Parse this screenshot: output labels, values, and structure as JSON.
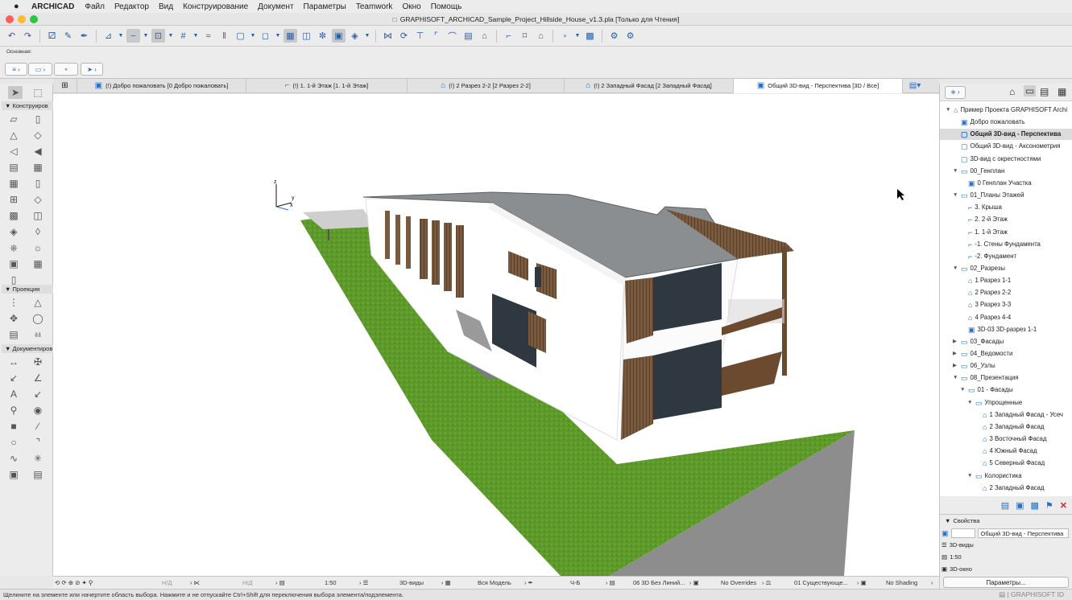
{
  "menubar": {
    "apple": "",
    "app_name": "ARCHICAD",
    "items": [
      "Файл",
      "Редактор",
      "Вид",
      "Конструирование",
      "Документ",
      "Параметры",
      "Teamwork",
      "Окно",
      "Помощь"
    ]
  },
  "window": {
    "title": "GRAPHISOFT_ARCHICAD_Sample_Project_Hillside_House_v1.3.pla [Только для Чтения]"
  },
  "infobox": {
    "label": "Основная:"
  },
  "toolbox": {
    "sections": [
      "Конструиров",
      "Проекция",
      "Документиров"
    ]
  },
  "tabs": [
    {
      "label": "(!) Добро пожаловать [0 Добро пожаловать]",
      "icon": "welcome-icon"
    },
    {
      "label": "(!) 1. 1-й Этаж [1. 1-й Этаж]",
      "icon": "floorplan-icon"
    },
    {
      "label": "(!) 2 Разрез 2-2 [2 Разрез 2-2]",
      "icon": "section-icon"
    },
    {
      "label": "(!) 2 Западный Фасад [2 Западный Фасад]",
      "icon": "elevation-icon"
    },
    {
      "label": "Общий 3D-вид - Перспектива [3D / Все]",
      "icon": "3d-icon",
      "active": true
    }
  ],
  "navigator": {
    "items": [
      {
        "label": "Пример Проекта GRAPHISOFT Archi",
        "level": 0,
        "arrow": "▼",
        "icon": "⌂"
      },
      {
        "label": "Добро пожаловать",
        "level": 1,
        "arrow": "",
        "icon": "▣"
      },
      {
        "label": "Общий 3D-вид - Перспектива",
        "level": 1,
        "arrow": "",
        "icon": "▢",
        "selected": true
      },
      {
        "label": "Общий 3D-вид - Аксонометрия",
        "level": 1,
        "arrow": "",
        "icon": "▢"
      },
      {
        "label": "3D-вид с окрестностями",
        "level": 1,
        "arrow": "",
        "icon": "▢"
      },
      {
        "label": "00_Генплан",
        "level": 1,
        "arrow": "▼",
        "icon": "▭"
      },
      {
        "label": "0 Генплан Участка",
        "level": 2,
        "arrow": "",
        "icon": "▣"
      },
      {
        "label": "01_Планы Этажей",
        "level": 1,
        "arrow": "▼",
        "icon": "▭"
      },
      {
        "label": "3. Крыша",
        "level": 2,
        "arrow": "",
        "icon": "⌐"
      },
      {
        "label": "2. 2-й Этаж",
        "level": 2,
        "arrow": "",
        "icon": "⌐"
      },
      {
        "label": "1. 1-й Этаж",
        "level": 2,
        "arrow": "",
        "icon": "⌐"
      },
      {
        "label": "-1. Стены Фундамента",
        "level": 2,
        "arrow": "",
        "icon": "⌐"
      },
      {
        "label": "-2. Фундамент",
        "level": 2,
        "arrow": "",
        "icon": "⌐"
      },
      {
        "label": "02_Разрезы",
        "level": 1,
        "arrow": "▼",
        "icon": "▭"
      },
      {
        "label": "1 Разрез 1-1",
        "level": 2,
        "arrow": "",
        "icon": "⌂"
      },
      {
        "label": "2 Разрез 2-2",
        "level": 2,
        "arrow": "",
        "icon": "⌂"
      },
      {
        "label": "3 Разрез 3-3",
        "level": 2,
        "arrow": "",
        "icon": "⌂"
      },
      {
        "label": "4 Разрез 4-4",
        "level": 2,
        "arrow": "",
        "icon": "⌂"
      },
      {
        "label": "3D-03 3D-разрез 1-1",
        "level": 2,
        "arrow": "",
        "icon": "▣"
      },
      {
        "label": "03_Фасады",
        "level": 1,
        "arrow": "▶",
        "icon": "▭"
      },
      {
        "label": "04_Ведомости",
        "level": 1,
        "arrow": "▶",
        "icon": "▭"
      },
      {
        "label": "06_Узлы",
        "level": 1,
        "arrow": "▶",
        "icon": "▭"
      },
      {
        "label": "08_Презентация",
        "level": 1,
        "arrow": "▼",
        "icon": "▭"
      },
      {
        "label": "01 - Фасады",
        "level": 2,
        "arrow": "▼",
        "icon": "▭"
      },
      {
        "label": "Упрощенные",
        "level": 3,
        "arrow": "▼",
        "icon": "▭"
      },
      {
        "label": "1 Западный Фасад - Усеч",
        "level": 4,
        "arrow": "",
        "icon": "⌂"
      },
      {
        "label": "2 Западный Фасад",
        "level": 4,
        "arrow": "",
        "icon": "⌂"
      },
      {
        "label": "3 Восточный Фасад",
        "level": 4,
        "arrow": "",
        "icon": "⌂"
      },
      {
        "label": "4 Южный Фасад",
        "level": 4,
        "arrow": "",
        "icon": "⌂"
      },
      {
        "label": "5 Северный Фасад",
        "level": 4,
        "arrow": "",
        "icon": "⌂"
      },
      {
        "label": "Колористика",
        "level": 3,
        "arrow": "▼",
        "icon": "▭"
      },
      {
        "label": "2 Западный Фасад",
        "level": 4,
        "arrow": "",
        "icon": "⌂"
      }
    ]
  },
  "properties": {
    "header": "Свойства",
    "view_name": "Общий 3D-вид - Перспектива",
    "folder": "3D-виды",
    "scale": "1:50",
    "window_type": "3D-окно",
    "button": "Параметры..."
  },
  "viewbar": {
    "nd1": "Н/Д",
    "nd2": "Н/Д",
    "scale": "1:50",
    "layers": "3D-виды",
    "model": "Вся Модель",
    "pen": "Ч-Б",
    "mvo": "06 3D Без Линий...",
    "overrides": "No Overrides",
    "renovation": "01 Существующе...",
    "shading": "No Shading"
  },
  "statusbar": {
    "text": "Щелкните на элементе или начертите область выбора. Нажмите и не отпускайте Ctrl+Shift для переключения выбора элемента/подэлемента.",
    "graphisoft_id": "GRAPHISOFT ID"
  },
  "axes": {
    "x": "x",
    "y": "y",
    "z": "z"
  },
  "colors": {
    "accent": "#2a6fc0",
    "grass": "#5e9a2a",
    "roof": "#8a8e90",
    "wood": "#7a5a3e"
  }
}
